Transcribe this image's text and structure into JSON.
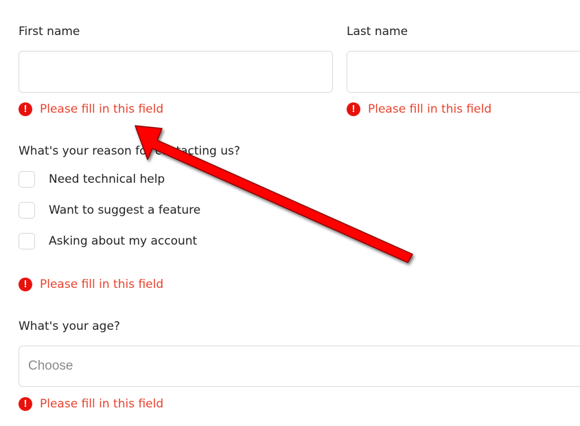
{
  "form": {
    "first_name": {
      "label": "First name",
      "value": "",
      "error": "Please fill in this field"
    },
    "last_name": {
      "label": "Last name",
      "value": "",
      "error": "Please fill in this field"
    },
    "reason": {
      "question": "What's your reason for contacting us?",
      "options": [
        {
          "label": "Need technical help",
          "checked": false
        },
        {
          "label": "Want to suggest a feature",
          "checked": false
        },
        {
          "label": "Asking about my account",
          "checked": false
        }
      ],
      "error": "Please fill in this field"
    },
    "age": {
      "question": "What's your age?",
      "placeholder": "Choose",
      "error": "Please fill in this field"
    }
  },
  "icons": {
    "error_icon": "exclamation-circle-icon",
    "error_glyph": "!"
  },
  "annotation": {
    "type": "arrow",
    "color": "#ff0000"
  },
  "colors": {
    "error_text": "#e8412c",
    "error_icon": "#e8120c",
    "border": "#d9d9d9",
    "text": "#222222",
    "placeholder": "#8a8a8a"
  }
}
